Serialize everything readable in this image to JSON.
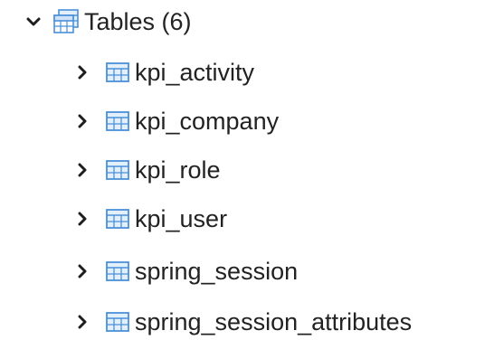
{
  "tree": {
    "folder": {
      "label": "Tables (6)",
      "expanded": true,
      "chevron_icon": "chevron-down-icon",
      "icon": "tables-folder-icon"
    },
    "items": [
      {
        "label": "kpi_activity",
        "icon": "table-icon",
        "chevron_icon": "chevron-right-icon"
      },
      {
        "label": "kpi_company",
        "icon": "table-icon",
        "chevron_icon": "chevron-right-icon"
      },
      {
        "label": "kpi_role",
        "icon": "table-icon",
        "chevron_icon": "chevron-right-icon"
      },
      {
        "label": "kpi_user",
        "icon": "table-icon",
        "chevron_icon": "chevron-right-icon"
      },
      {
        "label": "spring_session",
        "icon": "table-icon",
        "chevron_icon": "chevron-right-icon"
      },
      {
        "label": "spring_session_attributes",
        "icon": "table-icon",
        "chevron_icon": "chevron-right-icon"
      }
    ]
  },
  "colors": {
    "icon_blue": "#4a90d9",
    "icon_fill": "#e3effb",
    "chevron": "#1e1e1e",
    "text": "#222222"
  }
}
